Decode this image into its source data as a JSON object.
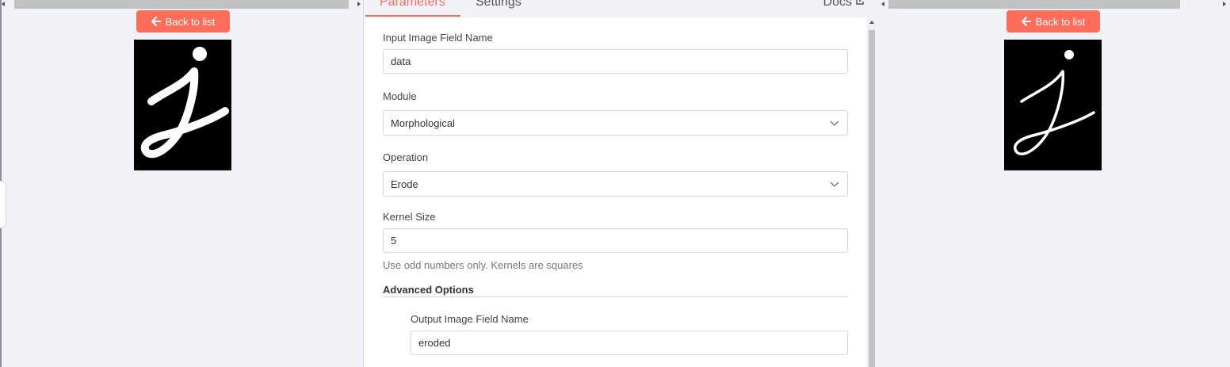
{
  "left_panel": {
    "back_button": "Back to list",
    "image_alt": "Input image: handwritten letter j (thick stroke)"
  },
  "parameters_panel": {
    "tabs": [
      "Parameters",
      "Settings"
    ],
    "docs_link": "Docs",
    "fields": {
      "input_image_field": {
        "label": "Input Image Field Name",
        "value": "data"
      },
      "module": {
        "label": "Module",
        "value": "Morphological"
      },
      "operation": {
        "label": "Operation",
        "value": "Erode"
      },
      "kernel_size": {
        "label": "Kernel Size",
        "value": "5",
        "hint": "Use odd numbers only. Kernels are squares"
      }
    },
    "advanced_options": {
      "title": "Advanced Options",
      "output_image_field": {
        "label": "Output Image Field Name",
        "value": "eroded"
      }
    }
  },
  "right_panel": {
    "back_button": "Back to list",
    "image_alt": "Output image: handwritten letter j (eroded, thin stroke)"
  },
  "colors": {
    "accent": "#ff6d5a",
    "background": "#f0f2f7"
  }
}
